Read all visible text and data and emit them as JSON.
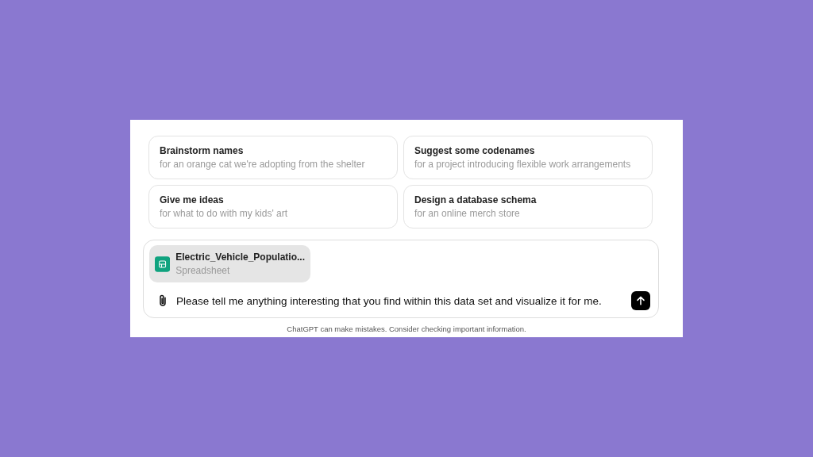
{
  "suggestions": [
    {
      "title": "Brainstorm names",
      "subtitle": "for an orange cat we're adopting from the shelter"
    },
    {
      "title": "Suggest some codenames",
      "subtitle": "for a project introducing flexible work arrangements"
    },
    {
      "title": "Give me ideas",
      "subtitle": "for what to do with my kids' art"
    },
    {
      "title": "Design a database schema",
      "subtitle": "for an online merch store"
    }
  ],
  "attachment": {
    "name": "Electric_Vehicle_Populatio...",
    "type": "Spreadsheet"
  },
  "composer": {
    "value": "Please tell me anything interesting that you find within this data set and visualize it for me."
  },
  "disclaimer": "ChatGPT can make mistakes. Consider checking important information."
}
